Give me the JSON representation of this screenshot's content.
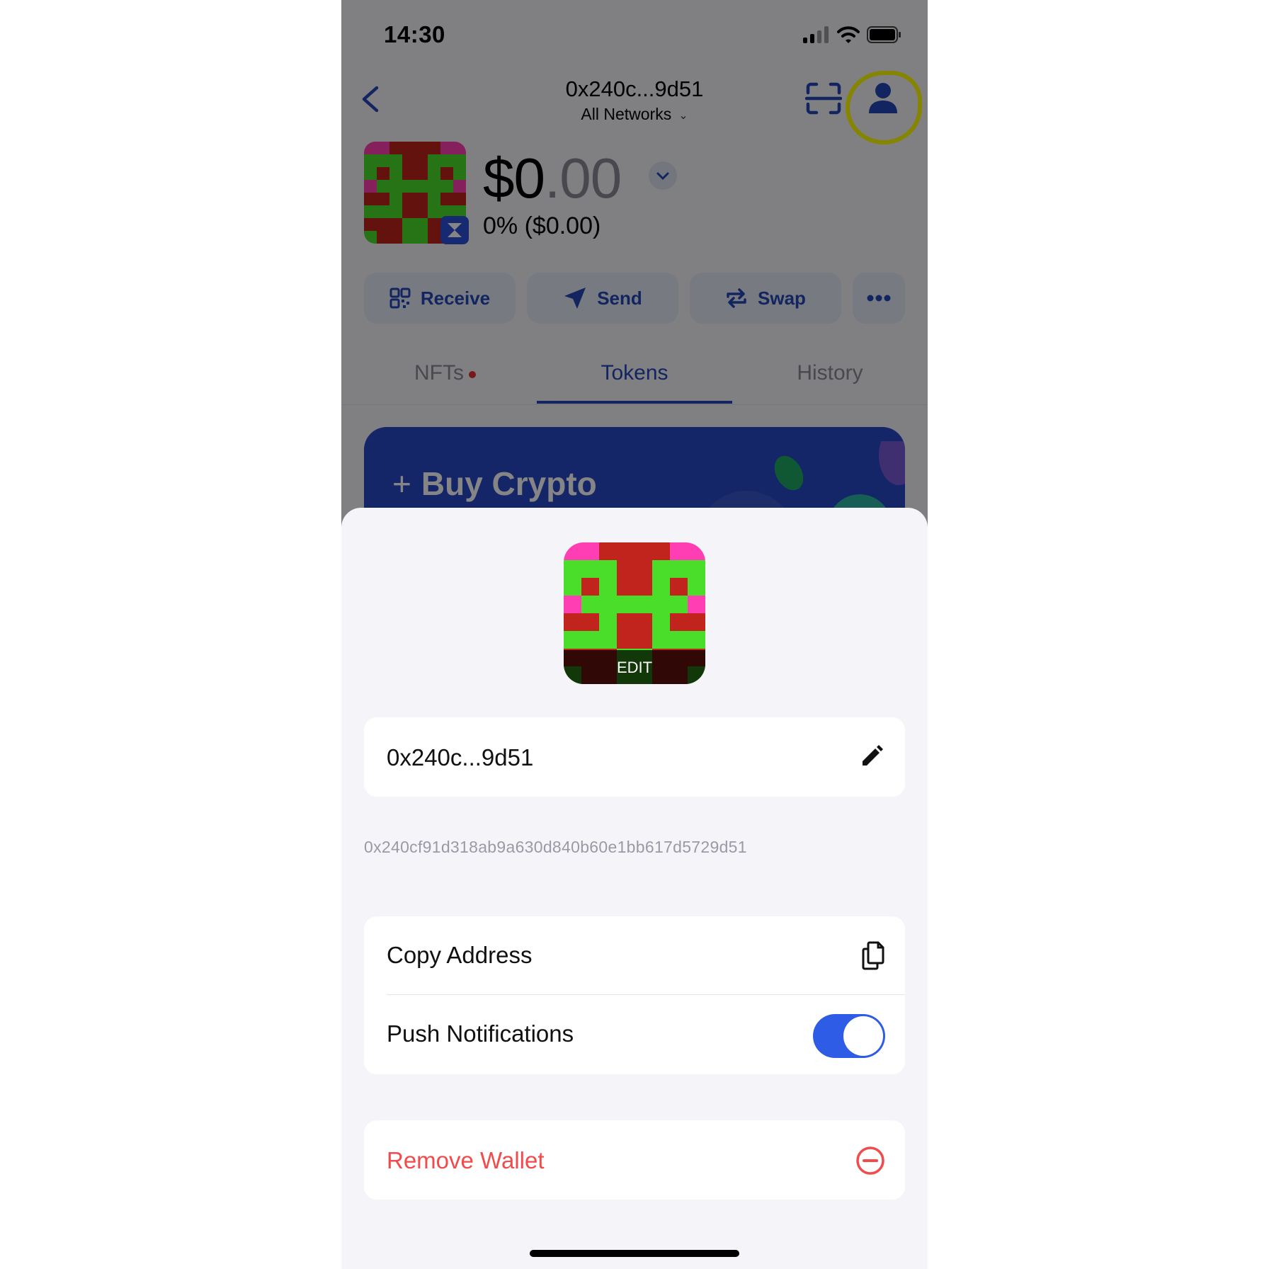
{
  "status_bar": {
    "time": "14:30"
  },
  "header": {
    "title": "0x240c...9d51",
    "network": "All Networks",
    "back_icon": "chevron-left-icon",
    "scan_icon": "scan-icon",
    "profile_icon": "person-icon"
  },
  "wallet": {
    "balance_whole": "$0",
    "balance_cents": ".00",
    "change": "0% ($0.00)"
  },
  "actions": [
    {
      "label": "Receive",
      "icon": "qr-code-icon"
    },
    {
      "label": "Send",
      "icon": "send-icon"
    },
    {
      "label": "Swap",
      "icon": "swap-icon"
    },
    {
      "label": "",
      "icon": "more-icon"
    }
  ],
  "tabs": [
    {
      "label": "NFTs",
      "has_dot": true
    },
    {
      "label": "Tokens",
      "active": true
    },
    {
      "label": "History"
    }
  ],
  "banner": {
    "label": "Buy Crypto",
    "icon": "plus-icon"
  },
  "sheet": {
    "avatar_edit_label": "EDIT",
    "wallet_name": "0x240c...9d51",
    "full_address": "0x240cf91d318ab9a630d840b60e1bb617d5729d51",
    "copy_address_label": "Copy Address",
    "push_notifications_label": "Push Notifications",
    "push_notifications_enabled": true,
    "remove_wallet_label": "Remove Wallet"
  },
  "colors": {
    "accent": "#2547b8",
    "toggle_on": "#2f5ce6",
    "danger": "#f24b4b",
    "highlight": "#ffff00",
    "avatar_pink": "#ff3eb3",
    "avatar_red": "#c0241c",
    "avatar_green": "#4ade2a"
  },
  "avatar_grid": [
    "PPRRRRPP",
    "GGGRRGGG",
    "GRGRRGRG",
    "PGGGGGGP",
    "RRGRRGRR",
    "GGGRRGGG",
    "RRRGGRRR",
    "GRRGGRRG"
  ]
}
